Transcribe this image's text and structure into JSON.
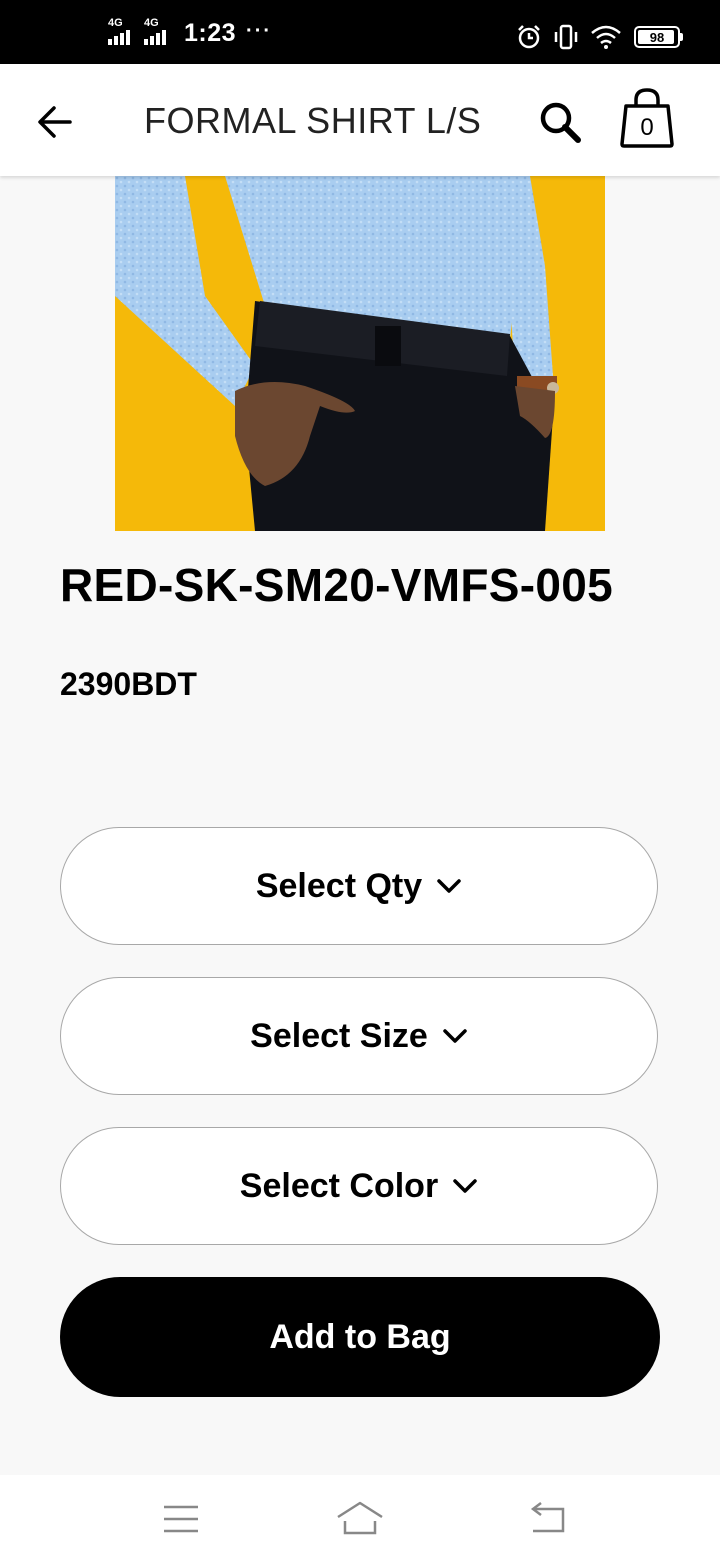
{
  "status_bar": {
    "signal1_label": "4G",
    "signal2_label": "4G",
    "time": "1:23",
    "more_indicator": "···",
    "battery": "98",
    "icons": [
      "alarm-icon",
      "vibrate-icon",
      "wifi-icon",
      "battery-icon"
    ]
  },
  "app_bar": {
    "title": "FORMAL SHIRT L/S",
    "bag_count": "0",
    "icons": [
      "back-arrow-icon",
      "search-icon",
      "shopping-bag-icon"
    ]
  },
  "product": {
    "image_description": "product photo",
    "name": "RED-SK-SM20-VMFS-005",
    "price": "2390BDT"
  },
  "options": {
    "qty_label": "Select Qty",
    "size_label": "Select Size",
    "color_label": "Select Color"
  },
  "actions": {
    "add_to_bag": "Add to Bag"
  },
  "nav_bar": {
    "icons": [
      "menu-icon",
      "home-icon",
      "back-icon"
    ]
  },
  "colors": {
    "accent_yellow": "#f4b400",
    "shirt_blue": "#a9cdf0",
    "pants_black": "#101218"
  }
}
